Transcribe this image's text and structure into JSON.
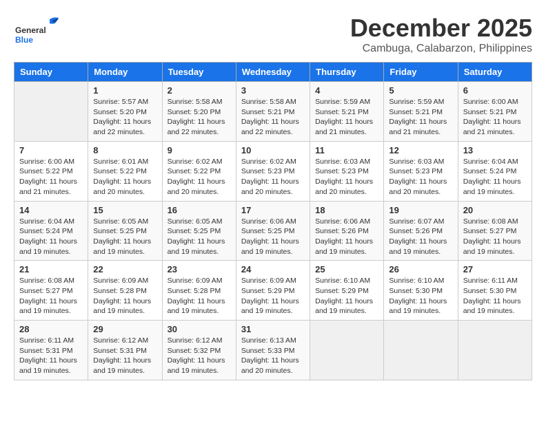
{
  "header": {
    "logo_general": "General",
    "logo_blue": "Blue",
    "month_year": "December 2025",
    "location": "Cambuga, Calabarzon, Philippines"
  },
  "weekdays": [
    "Sunday",
    "Monday",
    "Tuesday",
    "Wednesday",
    "Thursday",
    "Friday",
    "Saturday"
  ],
  "weeks": [
    [
      {
        "day": "",
        "info": ""
      },
      {
        "day": "1",
        "info": "Sunrise: 5:57 AM\nSunset: 5:20 PM\nDaylight: 11 hours\nand 22 minutes."
      },
      {
        "day": "2",
        "info": "Sunrise: 5:58 AM\nSunset: 5:20 PM\nDaylight: 11 hours\nand 22 minutes."
      },
      {
        "day": "3",
        "info": "Sunrise: 5:58 AM\nSunset: 5:21 PM\nDaylight: 11 hours\nand 22 minutes."
      },
      {
        "day": "4",
        "info": "Sunrise: 5:59 AM\nSunset: 5:21 PM\nDaylight: 11 hours\nand 21 minutes."
      },
      {
        "day": "5",
        "info": "Sunrise: 5:59 AM\nSunset: 5:21 PM\nDaylight: 11 hours\nand 21 minutes."
      },
      {
        "day": "6",
        "info": "Sunrise: 6:00 AM\nSunset: 5:21 PM\nDaylight: 11 hours\nand 21 minutes."
      }
    ],
    [
      {
        "day": "7",
        "info": "Sunrise: 6:00 AM\nSunset: 5:22 PM\nDaylight: 11 hours\nand 21 minutes."
      },
      {
        "day": "8",
        "info": "Sunrise: 6:01 AM\nSunset: 5:22 PM\nDaylight: 11 hours\nand 20 minutes."
      },
      {
        "day": "9",
        "info": "Sunrise: 6:02 AM\nSunset: 5:22 PM\nDaylight: 11 hours\nand 20 minutes."
      },
      {
        "day": "10",
        "info": "Sunrise: 6:02 AM\nSunset: 5:23 PM\nDaylight: 11 hours\nand 20 minutes."
      },
      {
        "day": "11",
        "info": "Sunrise: 6:03 AM\nSunset: 5:23 PM\nDaylight: 11 hours\nand 20 minutes."
      },
      {
        "day": "12",
        "info": "Sunrise: 6:03 AM\nSunset: 5:23 PM\nDaylight: 11 hours\nand 20 minutes."
      },
      {
        "day": "13",
        "info": "Sunrise: 6:04 AM\nSunset: 5:24 PM\nDaylight: 11 hours\nand 19 minutes."
      }
    ],
    [
      {
        "day": "14",
        "info": "Sunrise: 6:04 AM\nSunset: 5:24 PM\nDaylight: 11 hours\nand 19 minutes."
      },
      {
        "day": "15",
        "info": "Sunrise: 6:05 AM\nSunset: 5:25 PM\nDaylight: 11 hours\nand 19 minutes."
      },
      {
        "day": "16",
        "info": "Sunrise: 6:05 AM\nSunset: 5:25 PM\nDaylight: 11 hours\nand 19 minutes."
      },
      {
        "day": "17",
        "info": "Sunrise: 6:06 AM\nSunset: 5:25 PM\nDaylight: 11 hours\nand 19 minutes."
      },
      {
        "day": "18",
        "info": "Sunrise: 6:06 AM\nSunset: 5:26 PM\nDaylight: 11 hours\nand 19 minutes."
      },
      {
        "day": "19",
        "info": "Sunrise: 6:07 AM\nSunset: 5:26 PM\nDaylight: 11 hours\nand 19 minutes."
      },
      {
        "day": "20",
        "info": "Sunrise: 6:08 AM\nSunset: 5:27 PM\nDaylight: 11 hours\nand 19 minutes."
      }
    ],
    [
      {
        "day": "21",
        "info": "Sunrise: 6:08 AM\nSunset: 5:27 PM\nDaylight: 11 hours\nand 19 minutes."
      },
      {
        "day": "22",
        "info": "Sunrise: 6:09 AM\nSunset: 5:28 PM\nDaylight: 11 hours\nand 19 minutes."
      },
      {
        "day": "23",
        "info": "Sunrise: 6:09 AM\nSunset: 5:28 PM\nDaylight: 11 hours\nand 19 minutes."
      },
      {
        "day": "24",
        "info": "Sunrise: 6:09 AM\nSunset: 5:29 PM\nDaylight: 11 hours\nand 19 minutes."
      },
      {
        "day": "25",
        "info": "Sunrise: 6:10 AM\nSunset: 5:29 PM\nDaylight: 11 hours\nand 19 minutes."
      },
      {
        "day": "26",
        "info": "Sunrise: 6:10 AM\nSunset: 5:30 PM\nDaylight: 11 hours\nand 19 minutes."
      },
      {
        "day": "27",
        "info": "Sunrise: 6:11 AM\nSunset: 5:30 PM\nDaylight: 11 hours\nand 19 minutes."
      }
    ],
    [
      {
        "day": "28",
        "info": "Sunrise: 6:11 AM\nSunset: 5:31 PM\nDaylight: 11 hours\nand 19 minutes."
      },
      {
        "day": "29",
        "info": "Sunrise: 6:12 AM\nSunset: 5:31 PM\nDaylight: 11 hours\nand 19 minutes."
      },
      {
        "day": "30",
        "info": "Sunrise: 6:12 AM\nSunset: 5:32 PM\nDaylight: 11 hours\nand 19 minutes."
      },
      {
        "day": "31",
        "info": "Sunrise: 6:13 AM\nSunset: 5:33 PM\nDaylight: 11 hours\nand 20 minutes."
      },
      {
        "day": "",
        "info": ""
      },
      {
        "day": "",
        "info": ""
      },
      {
        "day": "",
        "info": ""
      }
    ]
  ]
}
